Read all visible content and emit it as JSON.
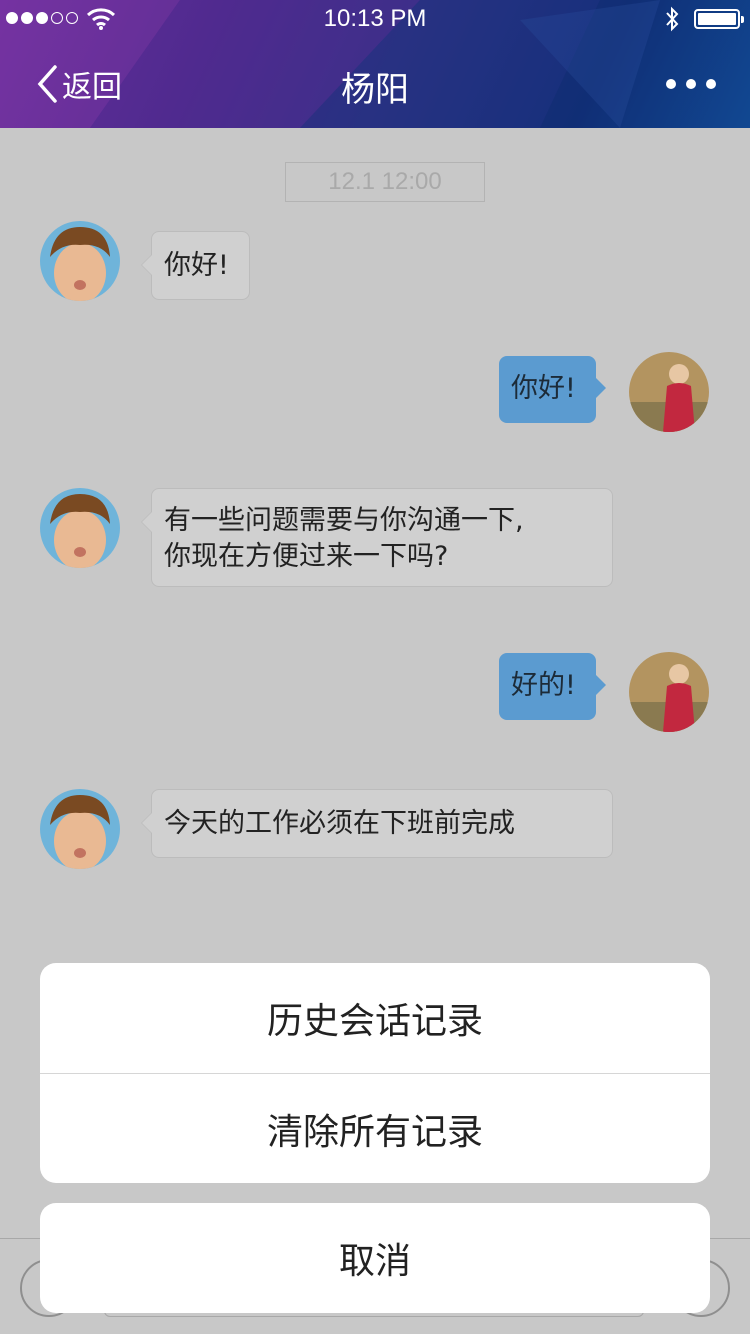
{
  "status_bar": {
    "time": "10:13 PM",
    "signal_dots": 5,
    "signal_filled": 3,
    "battery_level": 1.0
  },
  "nav": {
    "back_label": "返回",
    "title": "杨阳"
  },
  "chat": {
    "timestamp": "12.1 12:00",
    "messages": [
      {
        "side": "in",
        "text": "你好!"
      },
      {
        "side": "out",
        "text": "你好!"
      },
      {
        "side": "in",
        "lines": [
          "有一些问题需要与你沟通一下,",
          "你现在方便过来一下吗?"
        ]
      },
      {
        "side": "out",
        "text": "好的!"
      },
      {
        "side": "in",
        "text": "今天的工作必须在下班前完成"
      }
    ]
  },
  "action_sheet": {
    "history_label": "历史会话记录",
    "clear_label": "清除所有记录",
    "cancel_label": "取消"
  },
  "colors": {
    "accent": "#5b9bd0",
    "background": "#c8c8c8",
    "header_start": "#6b2f9e",
    "header_end": "#1358a6"
  }
}
